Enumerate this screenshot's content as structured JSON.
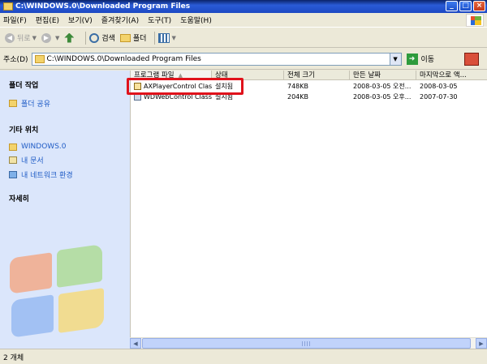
{
  "window": {
    "title": "C:\\WINDOWS.0\\Downloaded Program Files",
    "buttons": {
      "minimize": "_",
      "maximize": "□",
      "close": "×"
    }
  },
  "menu": [
    "파일(F)",
    "편집(E)",
    "보기(V)",
    "즐겨찾기(A)",
    "도구(T)",
    "도움말(H)"
  ],
  "toolbar": {
    "back": "뒤로",
    "search": "검색",
    "folders": "폴더"
  },
  "address": {
    "label": "주소(D)",
    "value": "C:\\WINDOWS.0\\Downloaded Program Files",
    "go_label": "이동"
  },
  "sidebar": {
    "tasks_title": "폴더 작업",
    "tasks": [
      "폴더 공유"
    ],
    "places_title": "기타 위치",
    "places": [
      "WINDOWS.0",
      "내 문서",
      "내 네트워크 환경"
    ],
    "details_title": "자세히"
  },
  "columns": [
    "프로그램 파일",
    "상태",
    "전체 크기",
    "만든 날짜",
    "마지막으로 액..."
  ],
  "files": [
    {
      "name": "AXPlayerControl Class",
      "status": "설치됨",
      "size": "748KB",
      "created": "2008-03-05 오전...",
      "accessed": "2008-03-05",
      "icon": "activex-icon"
    },
    {
      "name": "WDWebControl Class",
      "status": "설치됨",
      "size": "204KB",
      "created": "2008-03-05 오후...",
      "accessed": "2007-07-30",
      "icon": "activex-gear-icon"
    }
  ],
  "status": "2 개체",
  "colors": {
    "highlight": "#e0121b",
    "title_bar": "#0a246a",
    "sidebar": "#dbe6fb"
  }
}
